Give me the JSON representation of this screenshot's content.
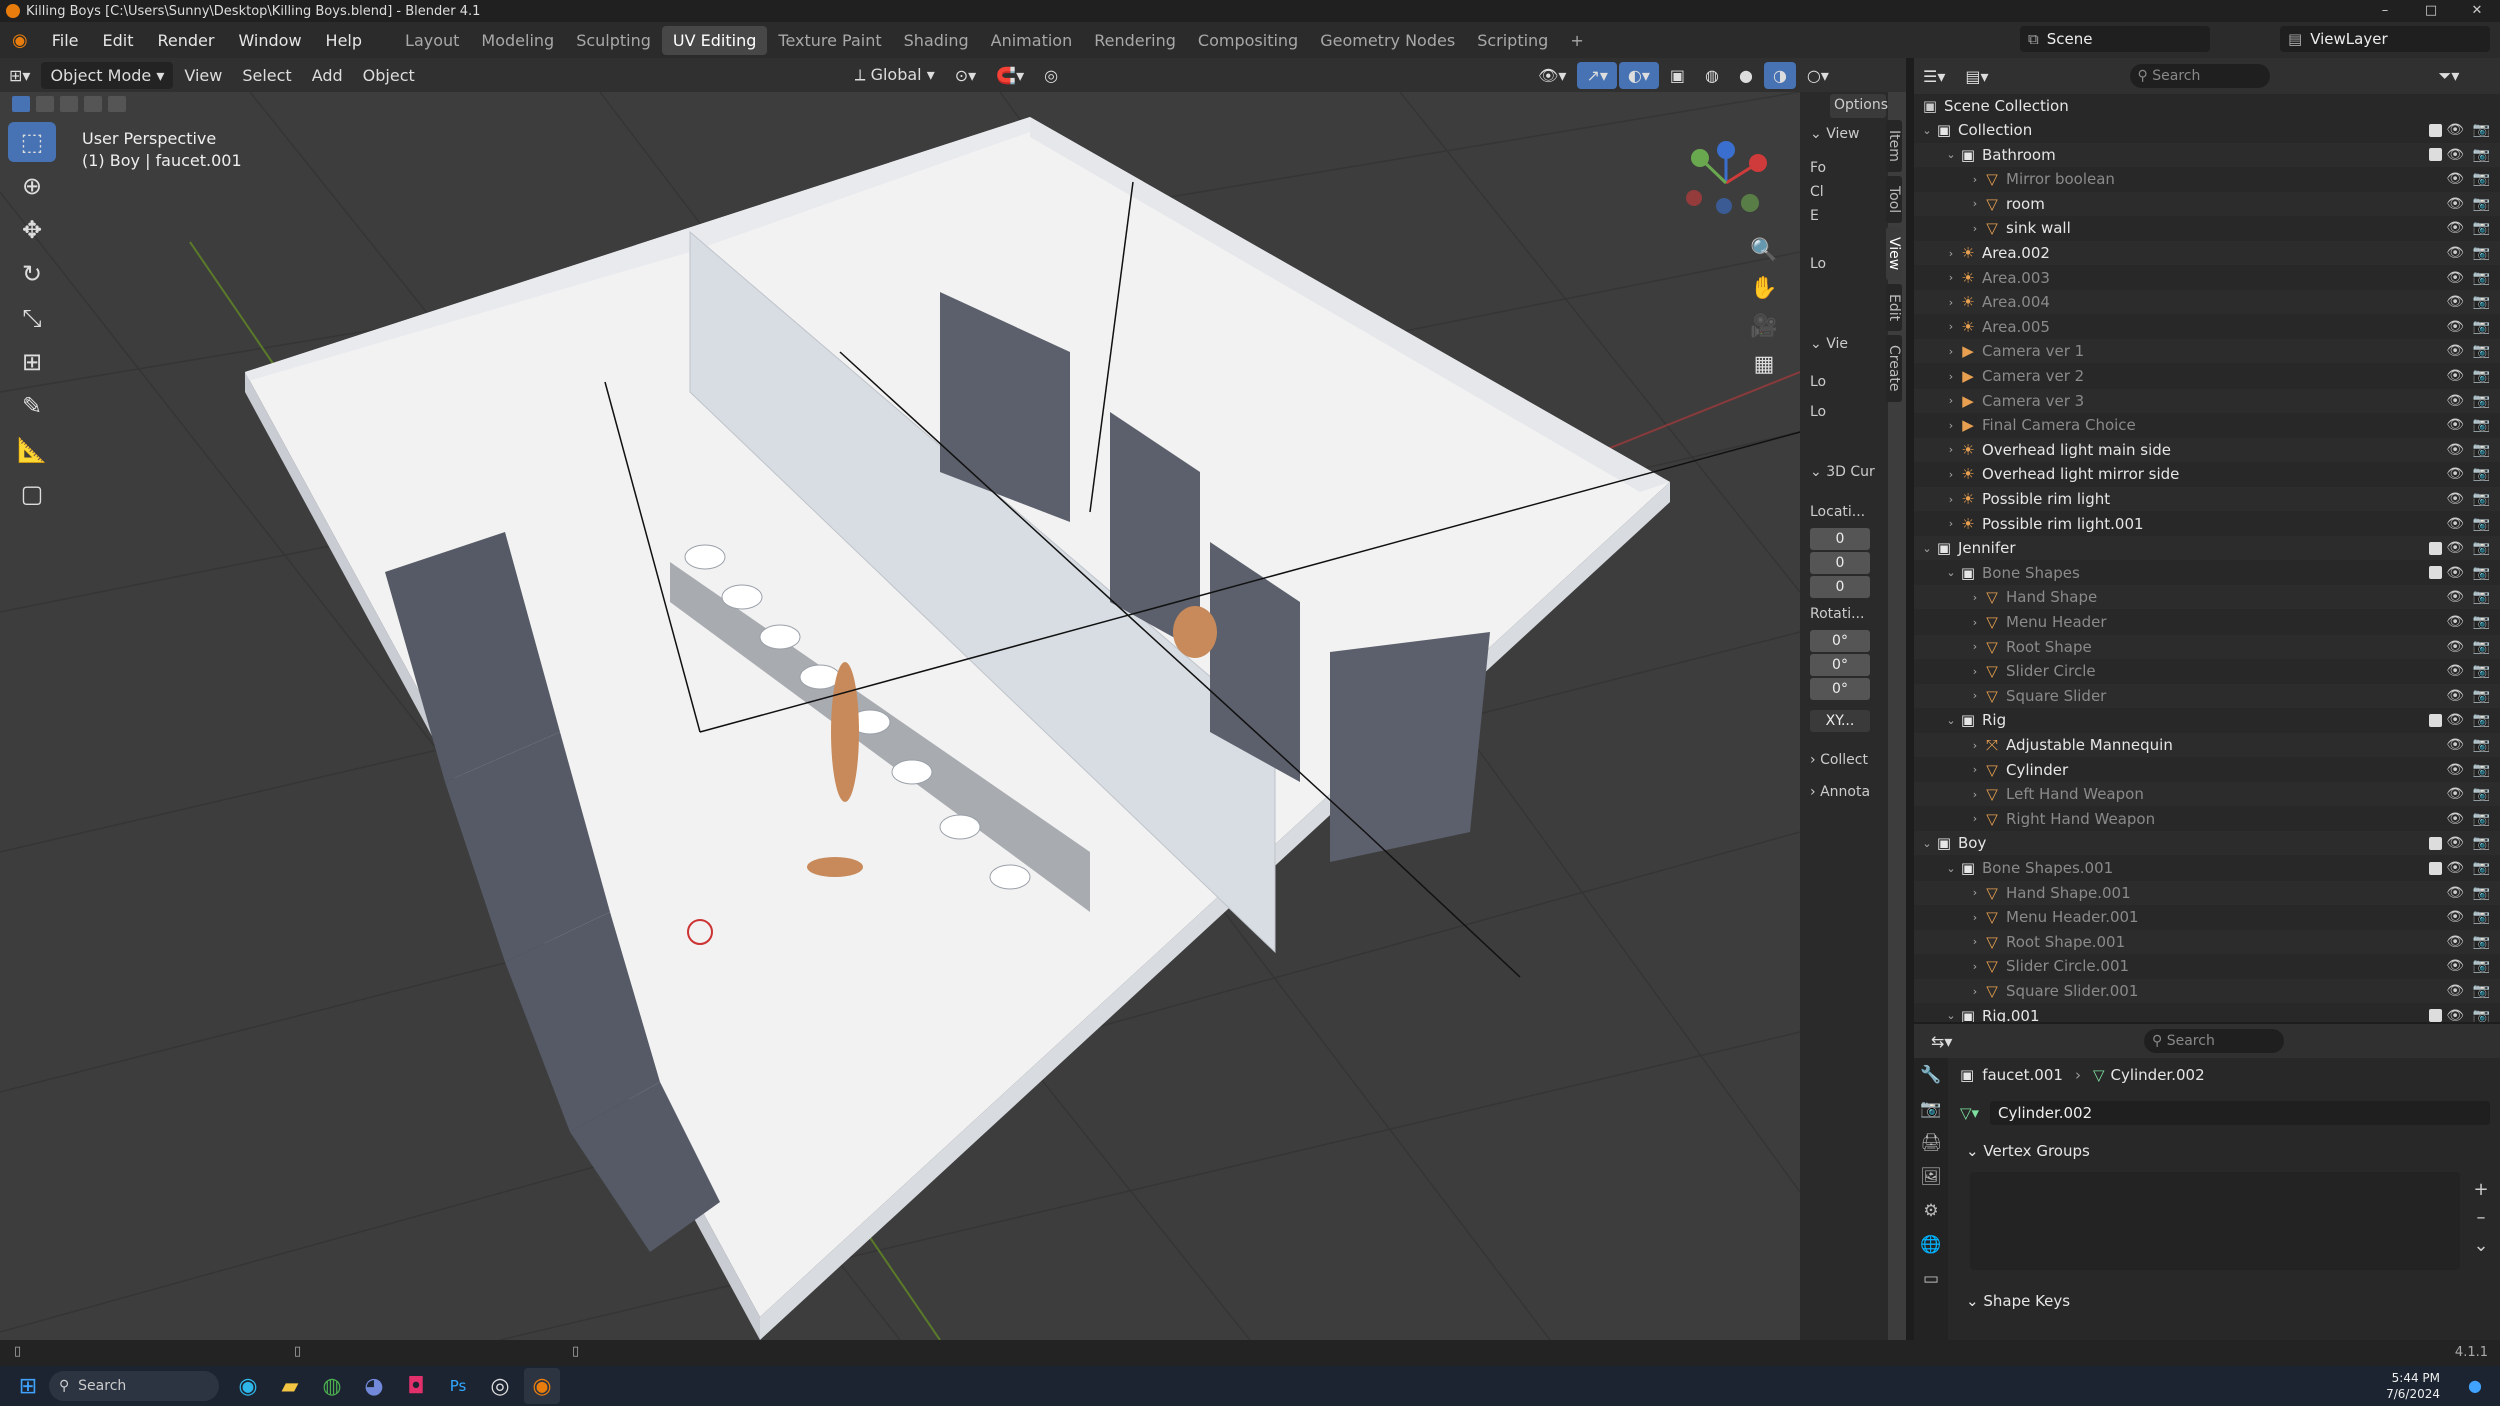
{
  "window": {
    "title": "Killing Boys [C:\\Users\\Sunny\\Desktop\\Killing Boys.blend] - Blender 4.1",
    "min": "–",
    "max": "□",
    "close": "✕"
  },
  "menus": [
    "File",
    "Edit",
    "Render",
    "Window",
    "Help"
  ],
  "workspaces": [
    "Layout",
    "Modeling",
    "Sculpting",
    "UV Editing",
    "Texture Paint",
    "Shading",
    "Animation",
    "Rendering",
    "Compositing",
    "Geometry Nodes",
    "Scripting",
    "+"
  ],
  "active_workspace": "UV Editing",
  "scene": "Scene",
  "view_layer": "ViewLayer",
  "viewport_header": {
    "mode": "Object Mode",
    "menus": [
      "View",
      "Select",
      "Add",
      "Object"
    ],
    "orientation": "Global"
  },
  "viewport": {
    "perspective": "User Perspective",
    "context": "(1) Boy | faucet.001",
    "options": "Options"
  },
  "npanel": {
    "sections": [
      "View",
      "Vie",
      "3D Cur",
      "Collect",
      "Annota"
    ],
    "labels": [
      "Fo",
      "Cl",
      "E",
      "Lo",
      "Lo",
      "Lo"
    ],
    "location_label": "Locati...",
    "location": [
      "0",
      "0",
      "0"
    ],
    "rotation_label": "Rotati...",
    "rotation": [
      "0°",
      "0°",
      "0°"
    ],
    "rot_mode": "XY...",
    "tabs": [
      "Item",
      "Tool",
      "View",
      "Edit",
      "Create"
    ]
  },
  "outliner": {
    "search_placeholder": "Search",
    "root": "Scene Collection",
    "rows": [
      {
        "name": "Collection",
        "depth": 0,
        "icon": "collection"
      },
      {
        "name": "Bathroom",
        "depth": 1,
        "icon": "collection"
      },
      {
        "name": "Mirror boolean",
        "depth": 2,
        "icon": "mesh",
        "dim": true
      },
      {
        "name": "room",
        "depth": 2,
        "icon": "mesh"
      },
      {
        "name": "sink wall",
        "depth": 2,
        "icon": "mesh"
      },
      {
        "name": "Area.002",
        "depth": 1,
        "icon": "light"
      },
      {
        "name": "Area.003",
        "depth": 1,
        "icon": "light",
        "dim": true
      },
      {
        "name": "Area.004",
        "depth": 1,
        "icon": "light",
        "dim": true
      },
      {
        "name": "Area.005",
        "depth": 1,
        "icon": "light",
        "dim": true
      },
      {
        "name": "Camera ver 1",
        "depth": 1,
        "icon": "camera",
        "dim": true
      },
      {
        "name": "Camera ver 2",
        "depth": 1,
        "icon": "camera",
        "dim": true
      },
      {
        "name": "Camera ver 3",
        "depth": 1,
        "icon": "camera",
        "dim": true
      },
      {
        "name": "Final Camera Choice",
        "depth": 1,
        "icon": "camera",
        "dim": true
      },
      {
        "name": "Overhead light main side",
        "depth": 1,
        "icon": "light"
      },
      {
        "name": "Overhead light mirror side",
        "depth": 1,
        "icon": "light"
      },
      {
        "name": "Possible rim light",
        "depth": 1,
        "icon": "light"
      },
      {
        "name": "Possible rim light.001",
        "depth": 1,
        "icon": "light"
      },
      {
        "name": "Jennifer",
        "depth": 0,
        "icon": "collection"
      },
      {
        "name": "Bone Shapes",
        "depth": 1,
        "icon": "collection",
        "dim": true
      },
      {
        "name": "Hand Shape",
        "depth": 2,
        "icon": "mesh",
        "dim": true
      },
      {
        "name": "Menu Header",
        "depth": 2,
        "icon": "mesh",
        "dim": true
      },
      {
        "name": "Root Shape",
        "depth": 2,
        "icon": "mesh",
        "dim": true
      },
      {
        "name": "Slider Circle",
        "depth": 2,
        "icon": "mesh",
        "dim": true
      },
      {
        "name": "Square Slider",
        "depth": 2,
        "icon": "mesh",
        "dim": true
      },
      {
        "name": "Rig",
        "depth": 1,
        "icon": "collection"
      },
      {
        "name": "Adjustable Mannequin",
        "depth": 2,
        "icon": "armature"
      },
      {
        "name": "Cylinder",
        "depth": 2,
        "icon": "mesh"
      },
      {
        "name": "Left Hand Weapon",
        "depth": 2,
        "icon": "mesh",
        "dim": true
      },
      {
        "name": "Right Hand Weapon",
        "depth": 2,
        "icon": "mesh",
        "dim": true
      },
      {
        "name": "Boy",
        "depth": 0,
        "icon": "collection"
      },
      {
        "name": "Bone Shapes.001",
        "depth": 1,
        "icon": "collection",
        "dim": true
      },
      {
        "name": "Hand Shape.001",
        "depth": 2,
        "icon": "mesh",
        "dim": true
      },
      {
        "name": "Menu Header.001",
        "depth": 2,
        "icon": "mesh",
        "dim": true
      },
      {
        "name": "Root Shape.001",
        "depth": 2,
        "icon": "mesh",
        "dim": true
      },
      {
        "name": "Slider Circle.001",
        "depth": 2,
        "icon": "mesh",
        "dim": true
      },
      {
        "name": "Square Slider.001",
        "depth": 2,
        "icon": "mesh",
        "dim": true
      },
      {
        "name": "Rig.001",
        "depth": 1,
        "icon": "collection"
      }
    ]
  },
  "properties": {
    "search_placeholder": "Search",
    "object": "faucet.001",
    "data": "Cylinder.002",
    "mesh_name": "Cylinder.002",
    "vertex_groups": "Vertex Groups",
    "shape_keys": "Shape Keys"
  },
  "status": {
    "version": "4.1.1"
  },
  "taskbar": {
    "search": "Search",
    "time": "5:44 PM",
    "date": "7/6/2024"
  },
  "colors": {
    "accent": "#4772b3",
    "orange": "#e87d0d",
    "mesh": "#e8a050",
    "modifier": "#4fb8d8",
    "vertex": "#7ddfa0"
  }
}
